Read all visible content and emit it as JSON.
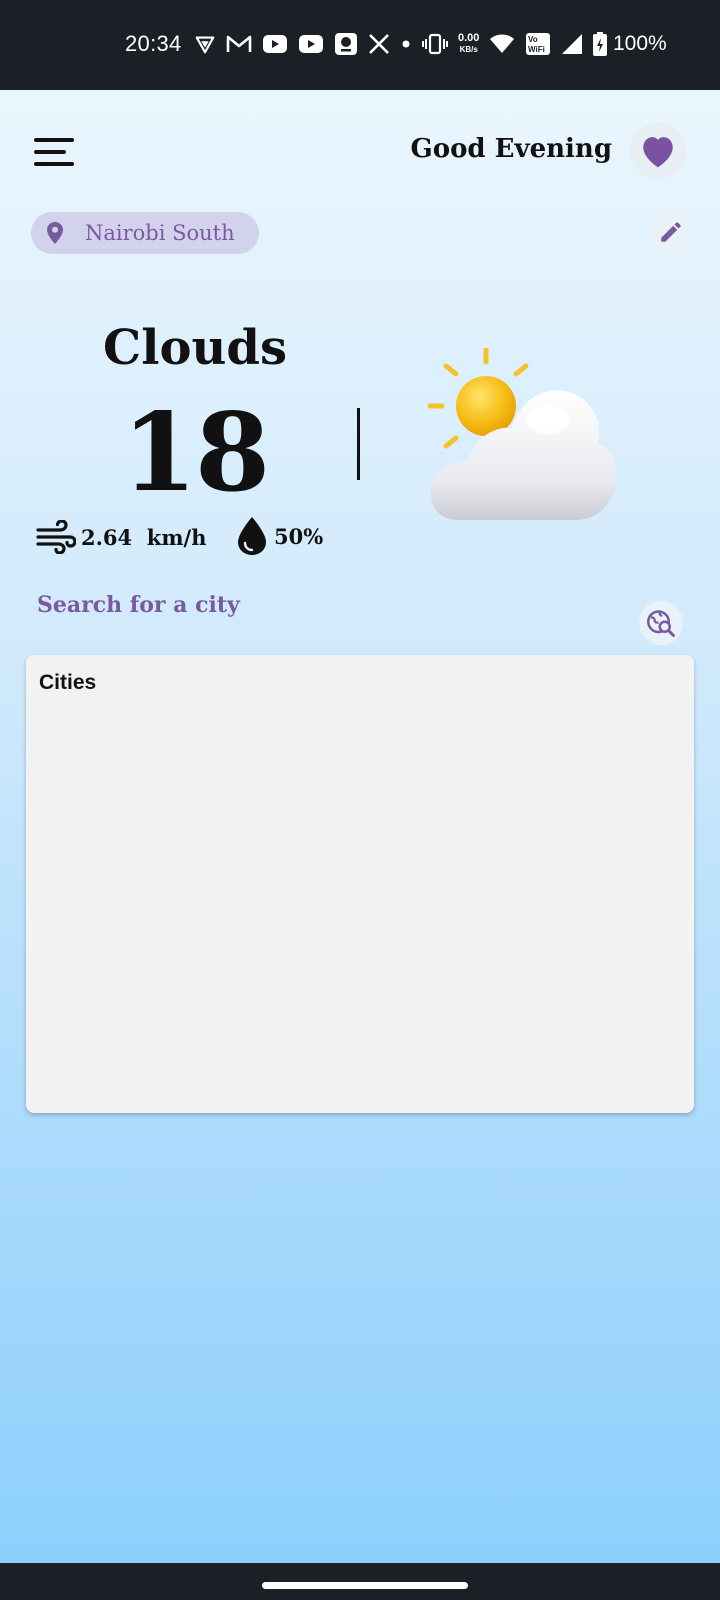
{
  "status_bar": {
    "time": "20:34",
    "net_speed_value": "0.00",
    "net_speed_unit": "KB/s",
    "vowifi_label_top": "Vo",
    "vowifi_label_bottom": "WiFi",
    "battery_text": "100%",
    "icons": [
      "vpn-icon",
      "gmail-icon",
      "youtube-icon",
      "youtube-icon",
      "app-icon",
      "x-icon",
      "dot-icon",
      "vibrate-icon",
      "net-speed",
      "wifi-icon",
      "vowifi-icon",
      "signal-icon",
      "battery-icon"
    ]
  },
  "header": {
    "greeting": "Good Evening",
    "menu_icon": "hamburger-menu-icon",
    "favorite_icon": "heart-icon"
  },
  "location": {
    "label": "Nairobi South",
    "icon": "location-pin-icon",
    "edit_icon": "pencil-icon"
  },
  "weather": {
    "condition": "Clouds",
    "temperature": "18",
    "wind": "2.64  km/h",
    "humidity": "50%",
    "icon": "sun-behind-cloud-icon",
    "wind_icon": "wind-icon",
    "humidity_icon": "water-drop-icon"
  },
  "search": {
    "label": "Search for a city",
    "icon": "travel-explore-icon"
  },
  "cities": {
    "title": "Cities",
    "items": []
  },
  "colors": {
    "accent": "#7a5a9e",
    "heart": "#7b52a2",
    "chip_background": "#d3d2ed",
    "card_background": "#f2f2f2",
    "system_bar": "#1b1f26"
  }
}
